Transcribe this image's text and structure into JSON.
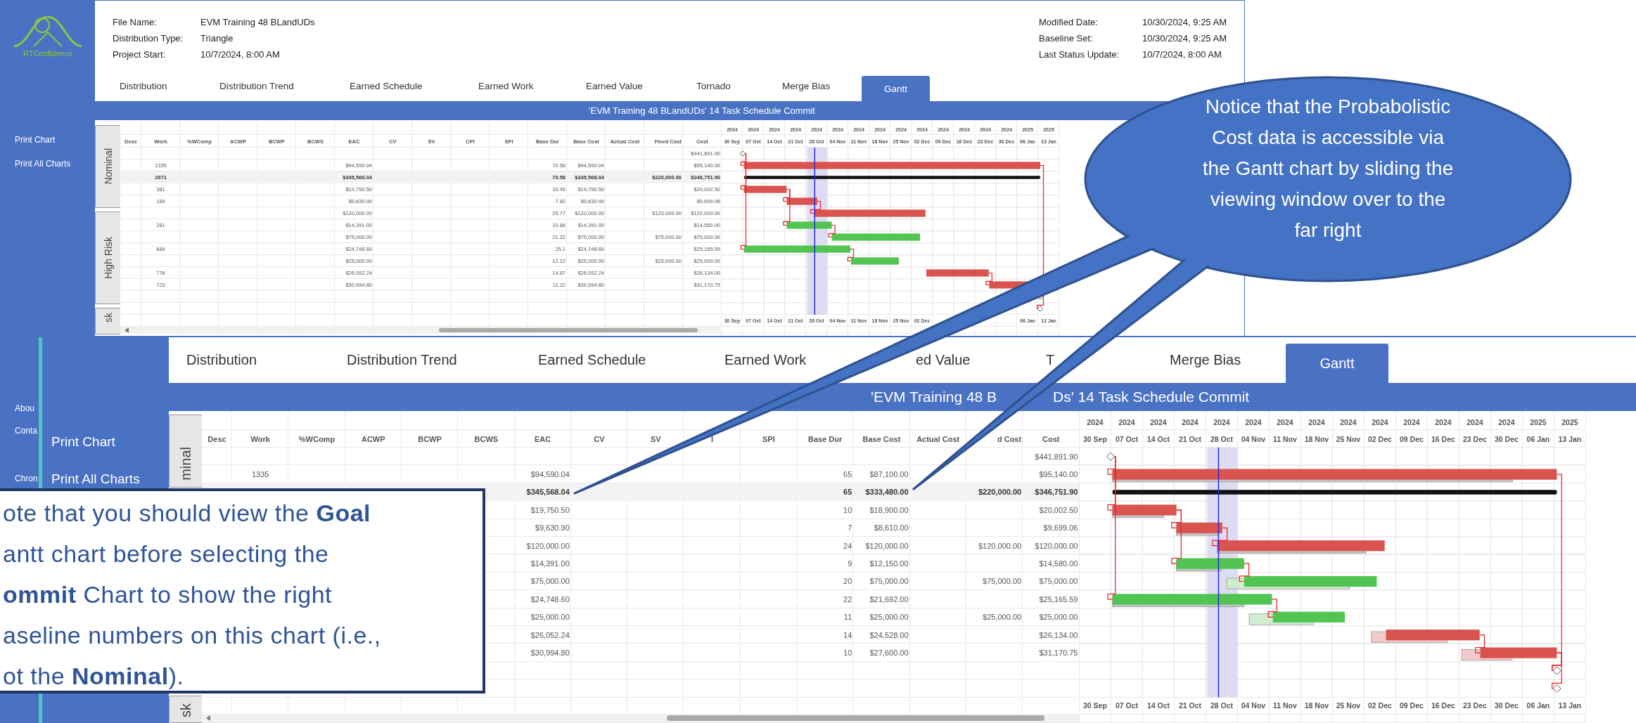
{
  "top_window": {
    "logo": "RTConfidence",
    "sidebar": [
      {
        "label": "Print Chart"
      },
      {
        "label": "Print All Charts"
      }
    ],
    "sidebar_more": [
      {
        "label": "Abou"
      },
      {
        "label": "Conta"
      },
      {
        "label": "Chron"
      }
    ],
    "file_info": [
      {
        "label": "File Name:",
        "value": "EVM Training 48 BLandUDs"
      },
      {
        "label": "Distribution Type:",
        "value": "Triangle"
      },
      {
        "label": "Project Start:",
        "value": "10/7/2024, 8:00 AM"
      }
    ],
    "status_info": [
      {
        "label": "Modified Date:",
        "value": "10/30/2024, 9:25 AM"
      },
      {
        "label": "Baseline Set:",
        "value": "10/30/2024, 9:25 AM"
      },
      {
        "label": "Last Status Update:",
        "value": "10/7/2024, 8:00 AM"
      }
    ],
    "tabs": [
      {
        "label": "Distribution",
        "selected": false
      },
      {
        "label": "Distribution Trend",
        "selected": false
      },
      {
        "label": "Earned Schedule",
        "selected": false
      },
      {
        "label": "Earned Work",
        "selected": false
      },
      {
        "label": "Earned Value",
        "selected": false
      },
      {
        "label": "Tornado",
        "selected": false
      },
      {
        "label": "Merge Bias",
        "selected": false
      },
      {
        "label": "Gantt",
        "selected": true
      }
    ],
    "chart_title": [
      "'EVM Training 48 BLandUDs' 14 Task Schedule Commit"
    ],
    "groups": [
      "Nominal",
      "High Risk",
      "sk"
    ],
    "columns": [
      "Desc",
      "Work",
      "%WComp",
      "ACWP",
      "BCWP",
      "BCWS",
      "EAC",
      "CV",
      "SV",
      "CPI",
      "SPI",
      "Base Dur",
      "Base Cost",
      "Actual Cost",
      "Fixed Cost",
      "Cost"
    ],
    "rows": [
      {
        "summary": false,
        "cost": "$441,891.90"
      },
      {
        "summary": false,
        "work": "1335",
        "eac": "$94,590.04",
        "base_dur": "70.58",
        "base_cost": "$94,590.04",
        "cost": "$95,140.00"
      },
      {
        "summary": true,
        "work": "2971",
        "eac": "$345,568.04",
        "base_dur": "70.58",
        "base_cost": "$345,568.04",
        "fixed_cost": "$220,000.00",
        "cost": "$346,751.90"
      },
      {
        "summary": false,
        "work": "381",
        "eac": "$19,750.50",
        "base_dur": "10.45",
        "base_cost": "$19,750.50",
        "cost": "$20,002.50"
      },
      {
        "summary": false,
        "work": "189",
        "eac": "$9,630.90",
        "base_dur": "7.82",
        "base_cost": "$9,630.90",
        "cost": "$9,699.06"
      },
      {
        "summary": false,
        "eac": "$120,000.00",
        "base_dur": "25.77",
        "base_cost": "$120,000.00",
        "fixed_cost": "$120,000.00",
        "cost": "$120,000.00"
      },
      {
        "summary": false,
        "work": "281",
        "eac": "$14,391.00",
        "base_dur": "10.66",
        "base_cost": "$14,391.00",
        "cost": "$14,580.00"
      },
      {
        "summary": false,
        "eac": "$75,000.00",
        "base_dur": "21.32",
        "base_cost": "$75,000.00",
        "fixed_cost": "$75,000.00",
        "cost": "$75,000.00"
      },
      {
        "summary": false,
        "work": "684",
        "eac": "$24,748.60",
        "base_dur": "25.1",
        "base_cost": "$24,748.60",
        "cost": "$25,165.59"
      },
      {
        "summary": false,
        "eac": "$25,000.00",
        "base_dur": "12.12",
        "base_cost": "$25,000.00",
        "fixed_cost": "$25,000.00",
        "cost": "$25,000.00"
      },
      {
        "summary": false,
        "work": "776",
        "eac": "$26,052.24",
        "base_dur": "14.87",
        "base_cost": "$26,052.24",
        "cost": "$26,134.00"
      },
      {
        "summary": false,
        "work": "723",
        "eac": "$30,994.80",
        "base_dur": "11.22",
        "base_cost": "$30,994.80",
        "cost": "$31,170.75"
      }
    ],
    "gantt": {
      "years": [
        "2024",
        "2024",
        "2024",
        "2024",
        "2024",
        "2024",
        "2024",
        "2024",
        "2024",
        "2024",
        "2024",
        "2024",
        "2024",
        "2024",
        "2025",
        "2025"
      ],
      "dates": [
        "30 Sep",
        "07 Oct",
        "14 Oct",
        "21 Oct",
        "28 Oct",
        "04 Nov",
        "11 Nov",
        "18 Nov",
        "25 Nov",
        "02 Dec",
        "09 Dec",
        "16 Dec",
        "23 Dec",
        "30 Dec",
        "06 Jan",
        "13 Jan"
      ],
      "bottom_dates": [
        "30 Sep",
        "07 Oct",
        "14 Oct",
        "21 Oct",
        "28 Oct",
        "04 Nov",
        "11 Nov",
        "18 Nov",
        "25 Nov",
        "02 Dec"
      ],
      "bottom_dates_end": [
        "06 Jan",
        "13 Jan"
      ]
    }
  },
  "bottom_window": {
    "sidebar": [
      {
        "label": "Print Chart"
      },
      {
        "label": "Print All Charts"
      }
    ],
    "tabs": [
      {
        "label": "Distribution",
        "selected": false
      },
      {
        "label": "Distribution Trend",
        "selected": false
      },
      {
        "label": "Earned Schedule",
        "selected": false
      },
      {
        "label": "Earned Work",
        "selected": false
      },
      {
        "label": "ed Value",
        "selected": false
      },
      {
        "label": "T",
        "selected": false
      },
      {
        "label": "Merge Bias",
        "selected": false
      },
      {
        "label": "Gantt",
        "selected": true
      }
    ],
    "chart_title": [
      "'EVM Training 48 B",
      "Ds' 14 Task Schedule Commit"
    ],
    "groups": [
      "minal",
      "sk"
    ],
    "columns": [
      "Desc",
      "Work",
      "%WComp",
      "ACWP",
      "BCWP",
      "BCWS",
      "EAC",
      "CV",
      "SV",
      "I",
      "SPI",
      "Base Dur",
      "Base Cost",
      "Actual Cost",
      "d Cost",
      "Cost"
    ],
    "rows": [
      {
        "summary": false,
        "cost": "$441,891.90"
      },
      {
        "summary": false,
        "work": "1335",
        "eac": "$94,590.04",
        "base_dur": "65",
        "base_cost": "$87,100.00",
        "cost": "$95,140.00"
      },
      {
        "summary": true,
        "eac": "$345,568.04",
        "base_dur": "65",
        "base_cost": "$333,480.00",
        "fixed_cost": "$220,000.00",
        "cost": "$346,751.90"
      },
      {
        "summary": false,
        "eac": "$19,750.50",
        "base_dur": "10",
        "base_cost": "$18,900.00",
        "cost": "$20,002.50"
      },
      {
        "summary": false,
        "eac": "$9,630.90",
        "base_dur": "7",
        "base_cost": "$8,610.00",
        "cost": "$9,699.06"
      },
      {
        "summary": false,
        "eac": "$120,000.00",
        "base_dur": "24",
        "base_cost": "$120,000.00",
        "fixed_cost": "$120,000.00",
        "cost": "$120,000.00"
      },
      {
        "summary": false,
        "eac": "$14,391.00",
        "base_dur": "9",
        "base_cost": "$12,150.00",
        "cost": "$14,580.00"
      },
      {
        "summary": false,
        "eac": "$75,000.00",
        "base_dur": "20",
        "base_cost": "$75,000.00",
        "fixed_cost": "$75,000.00",
        "cost": "$75,000.00"
      },
      {
        "summary": false,
        "eac": "$24,748.60",
        "base_dur": "22",
        "base_cost": "$21,692.00",
        "cost": "$25,165.59"
      },
      {
        "summary": false,
        "eac": "$25,000.00",
        "base_dur": "11",
        "base_cost": "$25,000.00",
        "fixed_cost": "$25,000.00",
        "cost": "$25,000.00"
      },
      {
        "summary": false,
        "eac": "$26,052.24",
        "base_dur": "14",
        "base_cost": "$24,528.00",
        "cost": "$26,134.00"
      },
      {
        "summary": false,
        "eac": "$30,994.80",
        "base_dur": "10",
        "base_cost": "$27,600.00",
        "cost": "$31,170.75"
      }
    ],
    "gantt": {
      "years": [
        "2024",
        "2024",
        "2024",
        "2024",
        "2024",
        "2024",
        "2024",
        "2024",
        "2024",
        "2024",
        "2024",
        "2024",
        "2024",
        "2024",
        "2025",
        "2025"
      ],
      "dates": [
        "30 Sep",
        "07 Oct",
        "14 Oct",
        "21 Oct",
        "28 Oct",
        "04 Nov",
        "11 Nov",
        "18 Nov",
        "25 Nov",
        "02 Dec",
        "09 Dec",
        "16 Dec",
        "23 Dec",
        "30 Dec",
        "06 Jan",
        "13 Jan"
      ],
      "bottom_dates": [
        "30 Sep",
        "07 Oct",
        "14 Oct",
        "21 Oct",
        "28 Oct",
        "04 Nov",
        "11 Nov",
        "18 Nov",
        "25 Nov",
        "02 Dec",
        "09 Dec",
        "16 Dec",
        "23 Dec",
        "30 Dec",
        "06 Jan",
        "13 Jan"
      ]
    }
  },
  "note": {
    "lines": [
      "ote that you should view the **Goal**",
      "antt chart before selecting the",
      "**ommit** Chart to show the right",
      "aseline numbers on this chart (i.e.,",
      "ot the **Nominal**)."
    ]
  },
  "callout": {
    "lines": [
      "Notice that the Probabolistic",
      "Cost data is accessible via",
      "the Gantt chart by sliding the",
      "viewing window over to the",
      "far right"
    ]
  }
}
